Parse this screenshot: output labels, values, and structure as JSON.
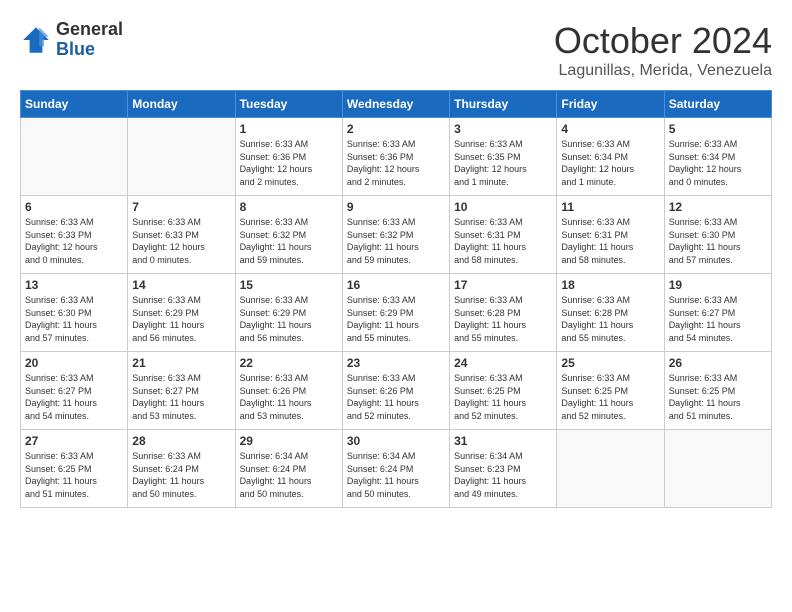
{
  "header": {
    "logo_line1": "General",
    "logo_line2": "Blue",
    "month": "October 2024",
    "location": "Lagunillas, Merida, Venezuela"
  },
  "weekdays": [
    "Sunday",
    "Monday",
    "Tuesday",
    "Wednesday",
    "Thursday",
    "Friday",
    "Saturday"
  ],
  "weeks": [
    [
      {
        "day": "",
        "info": ""
      },
      {
        "day": "",
        "info": ""
      },
      {
        "day": "1",
        "info": "Sunrise: 6:33 AM\nSunset: 6:36 PM\nDaylight: 12 hours\nand 2 minutes."
      },
      {
        "day": "2",
        "info": "Sunrise: 6:33 AM\nSunset: 6:36 PM\nDaylight: 12 hours\nand 2 minutes."
      },
      {
        "day": "3",
        "info": "Sunrise: 6:33 AM\nSunset: 6:35 PM\nDaylight: 12 hours\nand 1 minute."
      },
      {
        "day": "4",
        "info": "Sunrise: 6:33 AM\nSunset: 6:34 PM\nDaylight: 12 hours\nand 1 minute."
      },
      {
        "day": "5",
        "info": "Sunrise: 6:33 AM\nSunset: 6:34 PM\nDaylight: 12 hours\nand 0 minutes."
      }
    ],
    [
      {
        "day": "6",
        "info": "Sunrise: 6:33 AM\nSunset: 6:33 PM\nDaylight: 12 hours\nand 0 minutes."
      },
      {
        "day": "7",
        "info": "Sunrise: 6:33 AM\nSunset: 6:33 PM\nDaylight: 12 hours\nand 0 minutes."
      },
      {
        "day": "8",
        "info": "Sunrise: 6:33 AM\nSunset: 6:32 PM\nDaylight: 11 hours\nand 59 minutes."
      },
      {
        "day": "9",
        "info": "Sunrise: 6:33 AM\nSunset: 6:32 PM\nDaylight: 11 hours\nand 59 minutes."
      },
      {
        "day": "10",
        "info": "Sunrise: 6:33 AM\nSunset: 6:31 PM\nDaylight: 11 hours\nand 58 minutes."
      },
      {
        "day": "11",
        "info": "Sunrise: 6:33 AM\nSunset: 6:31 PM\nDaylight: 11 hours\nand 58 minutes."
      },
      {
        "day": "12",
        "info": "Sunrise: 6:33 AM\nSunset: 6:30 PM\nDaylight: 11 hours\nand 57 minutes."
      }
    ],
    [
      {
        "day": "13",
        "info": "Sunrise: 6:33 AM\nSunset: 6:30 PM\nDaylight: 11 hours\nand 57 minutes."
      },
      {
        "day": "14",
        "info": "Sunrise: 6:33 AM\nSunset: 6:29 PM\nDaylight: 11 hours\nand 56 minutes."
      },
      {
        "day": "15",
        "info": "Sunrise: 6:33 AM\nSunset: 6:29 PM\nDaylight: 11 hours\nand 56 minutes."
      },
      {
        "day": "16",
        "info": "Sunrise: 6:33 AM\nSunset: 6:29 PM\nDaylight: 11 hours\nand 55 minutes."
      },
      {
        "day": "17",
        "info": "Sunrise: 6:33 AM\nSunset: 6:28 PM\nDaylight: 11 hours\nand 55 minutes."
      },
      {
        "day": "18",
        "info": "Sunrise: 6:33 AM\nSunset: 6:28 PM\nDaylight: 11 hours\nand 55 minutes."
      },
      {
        "day": "19",
        "info": "Sunrise: 6:33 AM\nSunset: 6:27 PM\nDaylight: 11 hours\nand 54 minutes."
      }
    ],
    [
      {
        "day": "20",
        "info": "Sunrise: 6:33 AM\nSunset: 6:27 PM\nDaylight: 11 hours\nand 54 minutes."
      },
      {
        "day": "21",
        "info": "Sunrise: 6:33 AM\nSunset: 6:27 PM\nDaylight: 11 hours\nand 53 minutes."
      },
      {
        "day": "22",
        "info": "Sunrise: 6:33 AM\nSunset: 6:26 PM\nDaylight: 11 hours\nand 53 minutes."
      },
      {
        "day": "23",
        "info": "Sunrise: 6:33 AM\nSunset: 6:26 PM\nDaylight: 11 hours\nand 52 minutes."
      },
      {
        "day": "24",
        "info": "Sunrise: 6:33 AM\nSunset: 6:25 PM\nDaylight: 11 hours\nand 52 minutes."
      },
      {
        "day": "25",
        "info": "Sunrise: 6:33 AM\nSunset: 6:25 PM\nDaylight: 11 hours\nand 52 minutes."
      },
      {
        "day": "26",
        "info": "Sunrise: 6:33 AM\nSunset: 6:25 PM\nDaylight: 11 hours\nand 51 minutes."
      }
    ],
    [
      {
        "day": "27",
        "info": "Sunrise: 6:33 AM\nSunset: 6:25 PM\nDaylight: 11 hours\nand 51 minutes."
      },
      {
        "day": "28",
        "info": "Sunrise: 6:33 AM\nSunset: 6:24 PM\nDaylight: 11 hours\nand 50 minutes."
      },
      {
        "day": "29",
        "info": "Sunrise: 6:34 AM\nSunset: 6:24 PM\nDaylight: 11 hours\nand 50 minutes."
      },
      {
        "day": "30",
        "info": "Sunrise: 6:34 AM\nSunset: 6:24 PM\nDaylight: 11 hours\nand 50 minutes."
      },
      {
        "day": "31",
        "info": "Sunrise: 6:34 AM\nSunset: 6:23 PM\nDaylight: 11 hours\nand 49 minutes."
      },
      {
        "day": "",
        "info": ""
      },
      {
        "day": "",
        "info": ""
      }
    ]
  ]
}
